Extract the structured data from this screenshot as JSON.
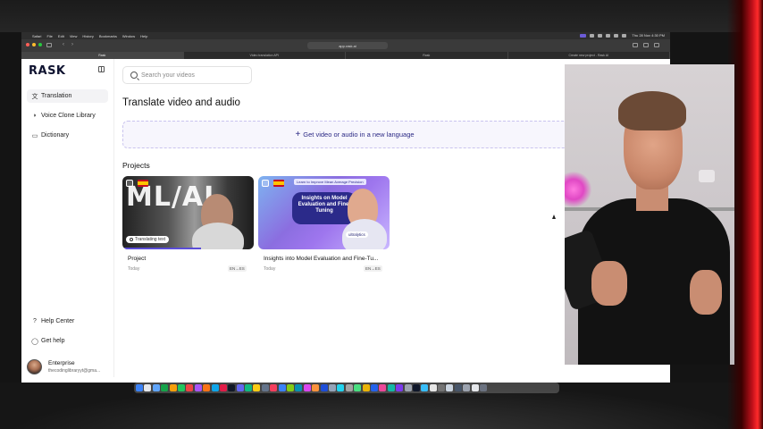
{
  "menubar": {
    "items": [
      "Safari",
      "File",
      "Edit",
      "View",
      "History",
      "Bookmarks",
      "Window",
      "Help"
    ],
    "clock": "Thu 28 Nov  4:30 PM"
  },
  "browser": {
    "url": "app.rask.ai",
    "tabs": [
      "Rask",
      "Video translation API",
      "Rask",
      "Create new project - Rask AI"
    ]
  },
  "app": {
    "logo": "RASK",
    "nav": [
      {
        "label": "Translation",
        "icon": "translate-icon",
        "glyph": "文"
      },
      {
        "label": "Voice Clone Library",
        "icon": "voice-icon",
        "glyph": "◗"
      },
      {
        "label": "Dictionary",
        "icon": "book-icon",
        "glyph": "▭"
      }
    ],
    "bottom_nav": [
      {
        "label": "Help Center",
        "icon": "help-icon",
        "glyph": "?"
      },
      {
        "label": "Get help",
        "icon": "chat-icon",
        "glyph": "◯"
      }
    ],
    "user": {
      "plan": "Enterprise",
      "email": "thecodinglibraryyt@gma..."
    },
    "search_placeholder": "Search your videos",
    "heading": "Translate video and audio",
    "upload_label": "Get video or audio in a new language",
    "projects_heading": "Projects",
    "projects": [
      {
        "title": "Project",
        "date": "Today",
        "langs": "EN→ES",
        "status": "Translating text",
        "thumb_text": "ML/AI",
        "progress": 0.6
      },
      {
        "title": "Insights into Model Evaluation and Fine-Tu...",
        "date": "Today",
        "langs": "EN→ES",
        "thumb_text": "Insights on Model Evaluation and Fine-Tuning",
        "thumb_tag": "Learn to Improve Mean Average Precision",
        "thumb_brand": "ultralytics"
      }
    ]
  },
  "colors": {
    "accent": "#5b4dd8",
    "upload_text": "#2c2a85",
    "glow": "#ff2a2a"
  }
}
